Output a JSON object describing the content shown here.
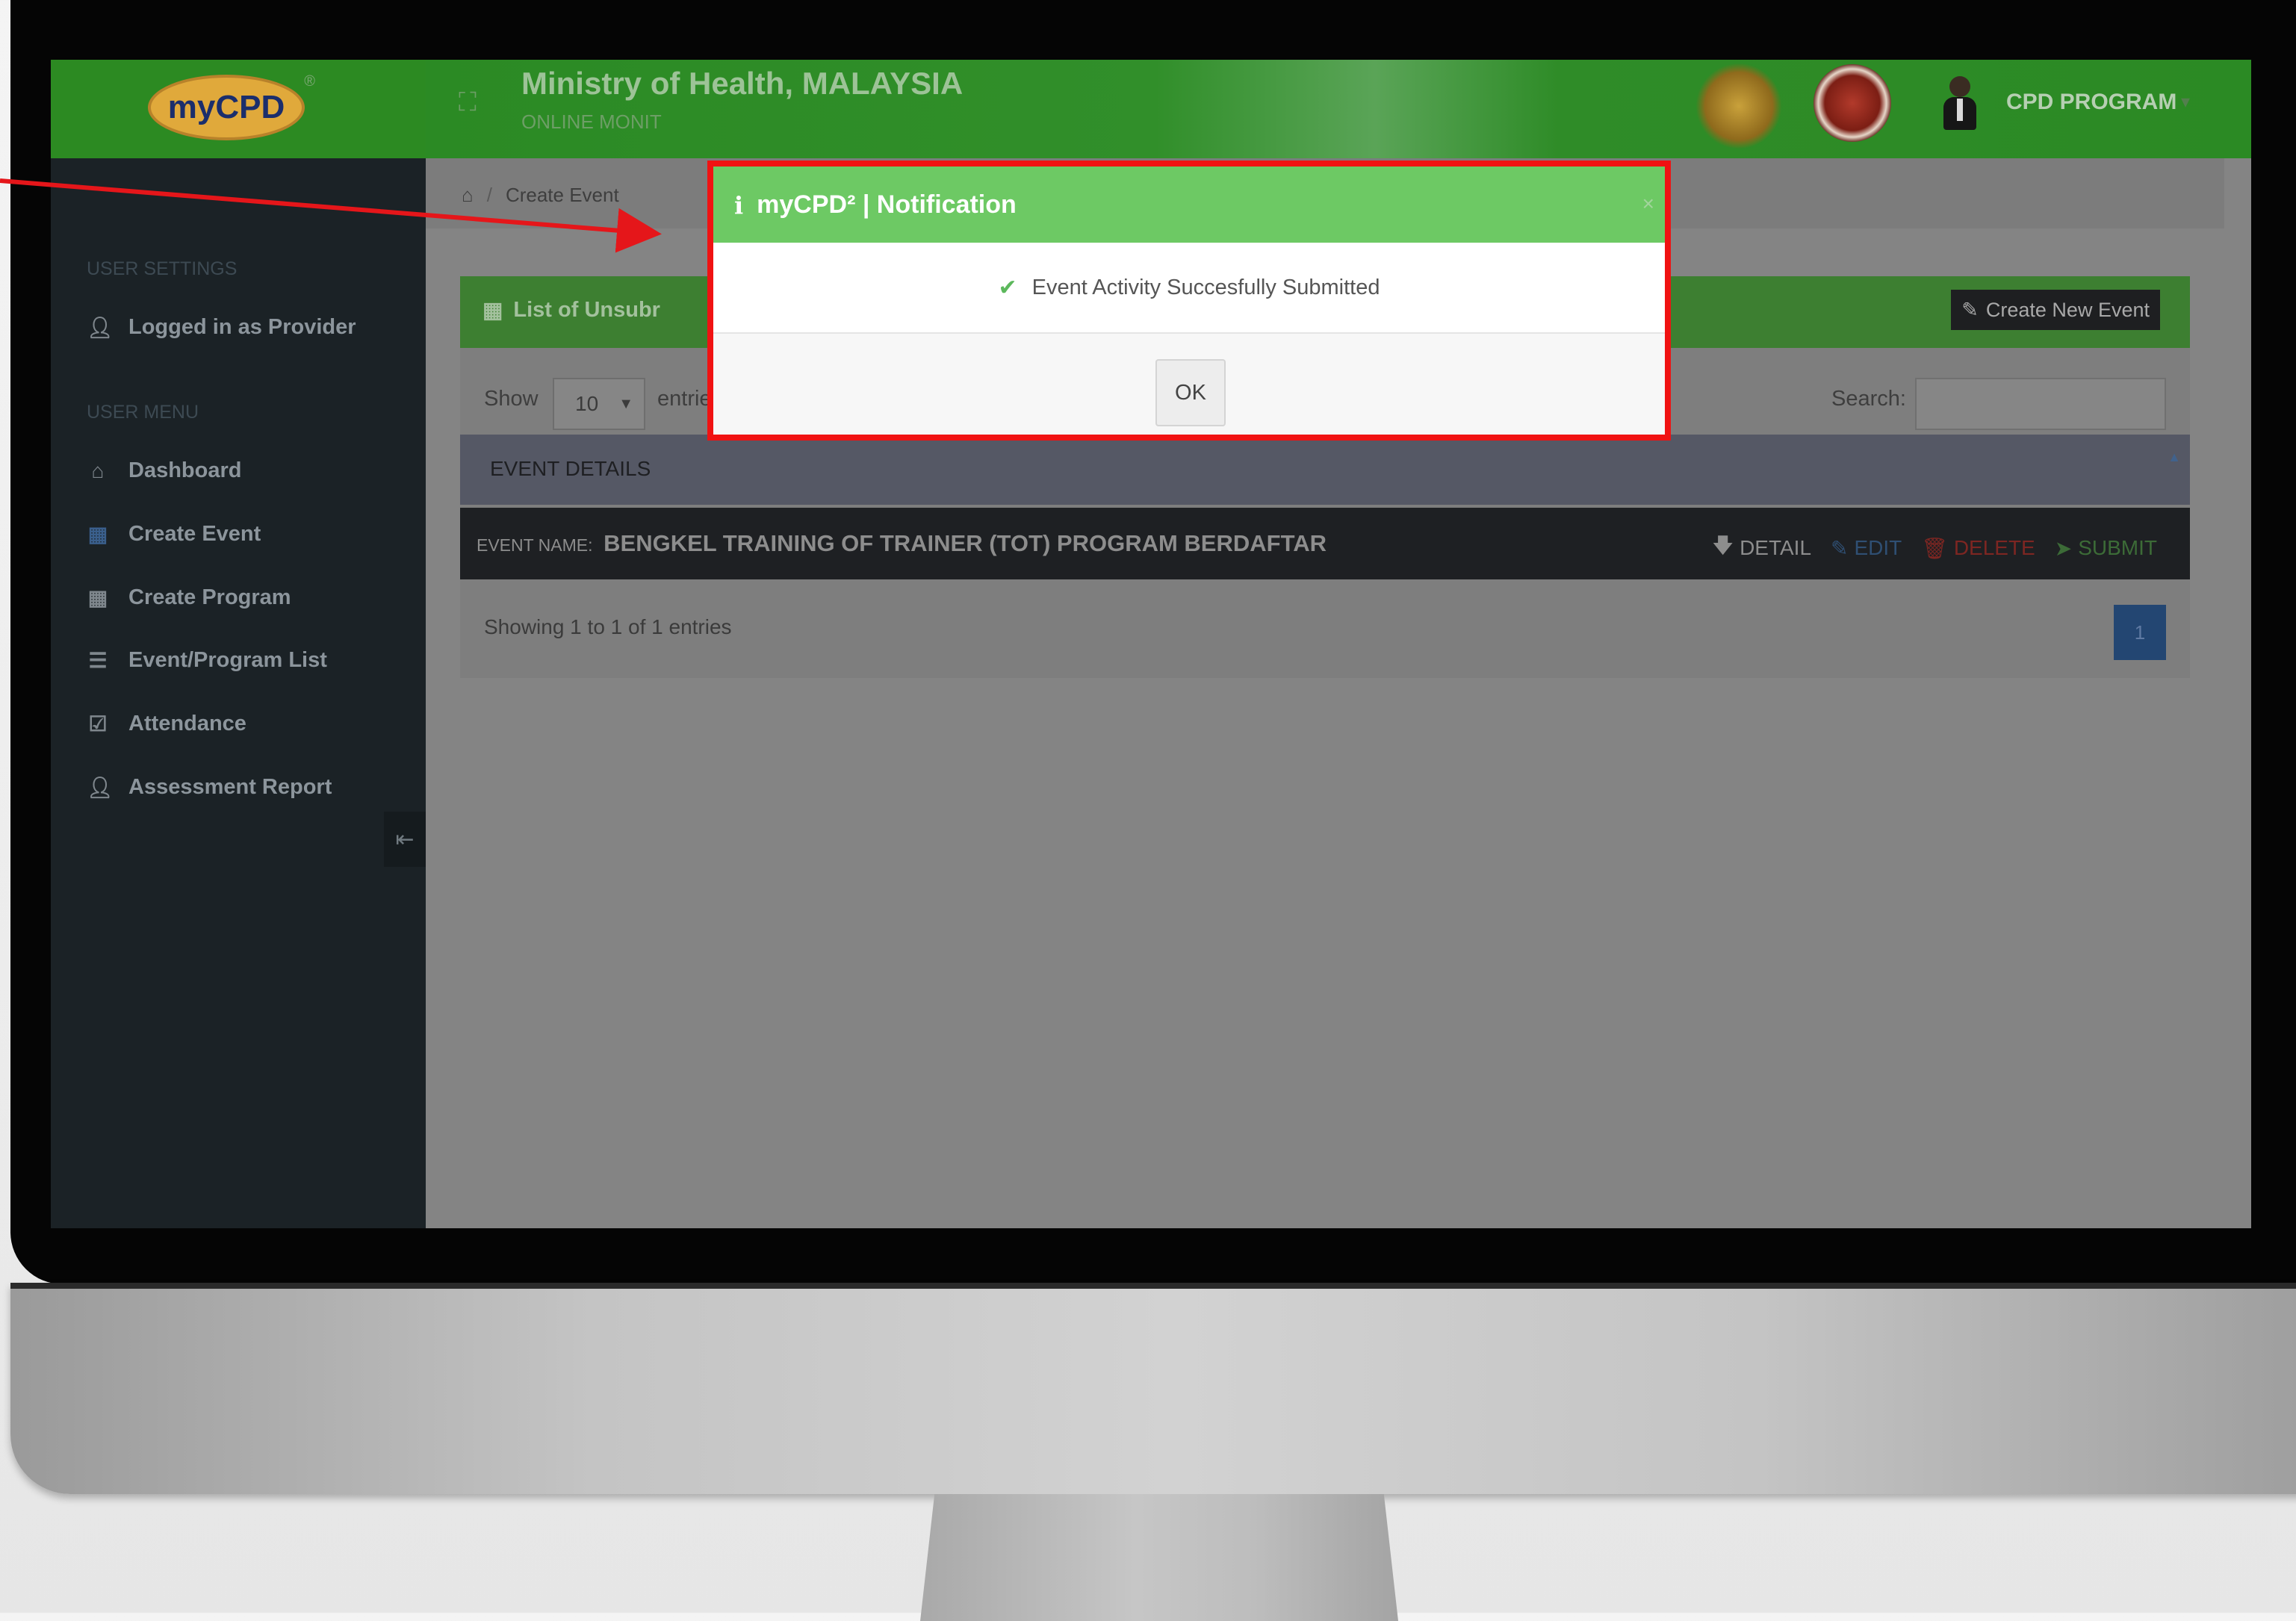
{
  "header": {
    "title": "Ministry of Health, MALAYSIA",
    "subtitle": "ONLINE MONIT",
    "logo_text": "myCPD",
    "logo_mark": "®",
    "user_label": "CPD PROGRAM"
  },
  "sidebar": {
    "settings_label": "USER SETTINGS",
    "logged_in": "Logged in as Provider",
    "menu_label": "USER MENU",
    "items": [
      {
        "label": "Dashboard",
        "icon": "home-icon"
      },
      {
        "label": "Create Event",
        "icon": "calendar-icon"
      },
      {
        "label": "Create Program",
        "icon": "calendar-icon"
      },
      {
        "label": "Event/Program List",
        "icon": "list-icon"
      },
      {
        "label": "Attendance",
        "icon": "checkbox-icon"
      },
      {
        "label": "Assessment Report",
        "icon": "user-icon"
      }
    ]
  },
  "breadcrumb": {
    "current": "Create Event"
  },
  "panel": {
    "title": "List of Unsubr",
    "new_event_label": "Create New Event"
  },
  "table": {
    "show_label": "Show",
    "length_value": "10",
    "entries_label": "entries",
    "search_label": "Search:",
    "column_header": "EVENT DETAILS",
    "rows": [
      {
        "name_label": "EVENT NAME:",
        "name": "BENGKEL TRAINING OF TRAINER (TOT) PROGRAM BERDAFTAR",
        "actions": {
          "detail": "DETAIL",
          "edit": "EDIT",
          "delete": "DELETE",
          "submit": "SUBMIT"
        }
      }
    ],
    "info": "Showing 1 to 1 of 1 entries",
    "current_page": "1"
  },
  "modal": {
    "title": "myCPD² | Notification",
    "close": "×",
    "message": "Event Activity Succesfully Submitted",
    "ok_label": "OK"
  },
  "colors": {
    "header_green": "#2b8a24",
    "modal_header_green": "#6dc964",
    "highlight_red": "#f01212",
    "sidebar_bg": "#1b2226",
    "page_button_blue": "#234672"
  }
}
